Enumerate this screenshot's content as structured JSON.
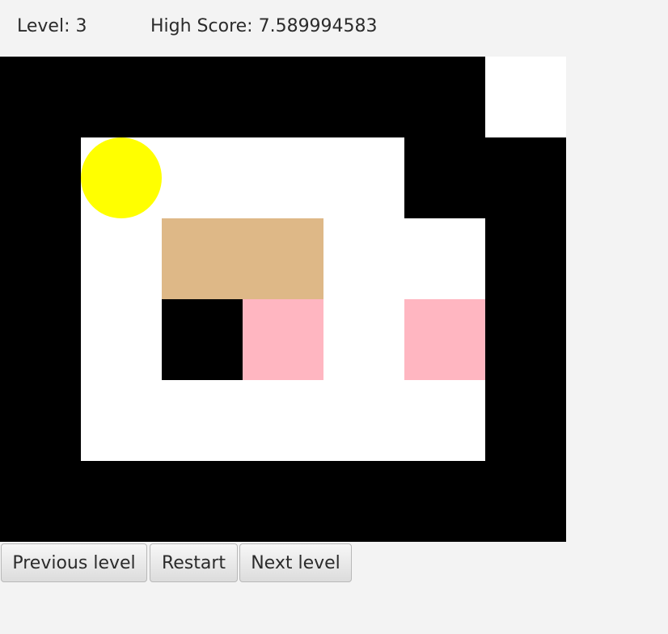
{
  "status": {
    "level_text": "Level: 3",
    "high_score_text": "High Score: 7.589994583"
  },
  "board": {
    "rows": [
      "######.",
      "#....##",
      "#.bb..#",
      "#.#p.p#",
      "#.....#",
      "#######"
    ],
    "player": {
      "row": 1,
      "col": 1
    },
    "colors": {
      "wall": "#000000",
      "floor": "#ffffff",
      "box": "#deb887",
      "goal": "#ffb6c1",
      "player": "#ffff00"
    }
  },
  "buttons": {
    "previous_label": "Previous level",
    "restart_label": "Restart",
    "next_label": "Next level"
  }
}
